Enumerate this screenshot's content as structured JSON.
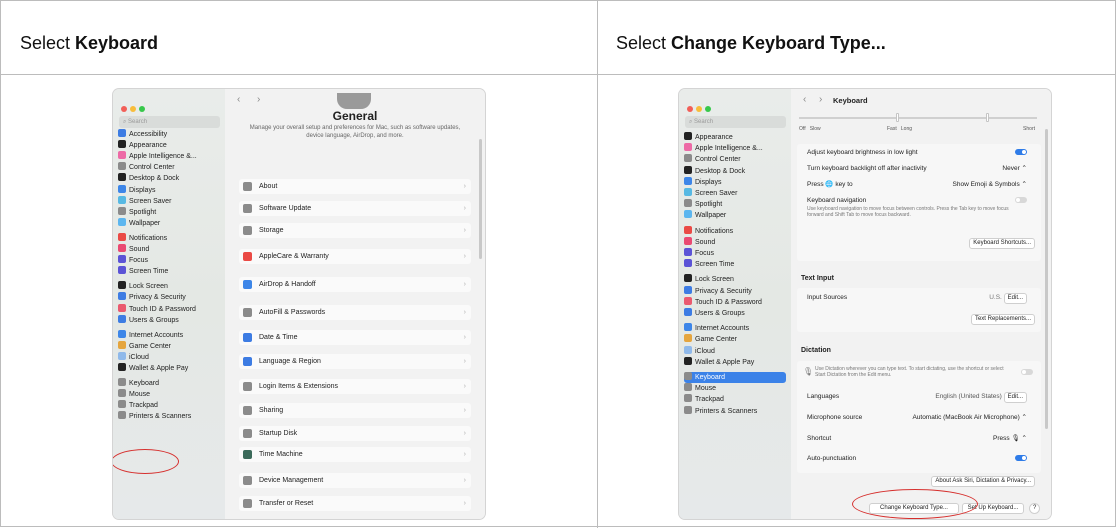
{
  "columns": [
    {
      "prefix": "Select ",
      "bold": "Keyboard"
    },
    {
      "prefix": "Select ",
      "bold": "Change Keyboard Type..."
    }
  ],
  "colors": {
    "accent": "#3b82e8",
    "highlight": "#d6302e",
    "close": "#f25f58",
    "minimize": "#f8bd3b",
    "zoom": "#37c84b"
  },
  "left": {
    "search_placeholder": "Search",
    "sidebar": [
      {
        "label": "Accessibility",
        "color": "#3d7ce3"
      },
      {
        "label": "Appearance",
        "color": "#222"
      },
      {
        "label": "Apple Intelligence &...",
        "color": "#ed6aa6"
      },
      {
        "label": "Control Center",
        "color": "#8b8b8b"
      },
      {
        "label": "Desktop & Dock",
        "color": "#222"
      },
      {
        "label": "Displays",
        "color": "#3d86e8"
      },
      {
        "label": "Screen Saver",
        "color": "#57b9e3"
      },
      {
        "label": "Spotlight",
        "color": "#8b8b8b"
      },
      {
        "label": "Wallpaper",
        "color": "#5cb6ef"
      },
      {
        "label": "Notifications",
        "color": "#ea4a45"
      },
      {
        "label": "Sound",
        "color": "#ea4a72"
      },
      {
        "label": "Focus",
        "color": "#5b53d6"
      },
      {
        "label": "Screen Time",
        "color": "#5b53d6"
      },
      {
        "label": "Lock Screen",
        "color": "#222"
      },
      {
        "label": "Privacy & Security",
        "color": "#3d7ce3"
      },
      {
        "label": "Touch ID & Password",
        "color": "#ea5a6f"
      },
      {
        "label": "Users & Groups",
        "color": "#3d7ce3"
      },
      {
        "label": "Internet Accounts",
        "color": "#3d86e8"
      },
      {
        "label": "Game Center",
        "color": "#e5a53e"
      },
      {
        "label": "iCloud",
        "color": "#8fb9ea"
      },
      {
        "label": "Wallet & Apple Pay",
        "color": "#222"
      },
      {
        "label": "Keyboard",
        "color": "#8b8b8b"
      },
      {
        "label": "Mouse",
        "color": "#8b8b8b"
      },
      {
        "label": "Trackpad",
        "color": "#8b8b8b"
      },
      {
        "label": "Printers & Scanners",
        "color": "#8b8b8b"
      }
    ],
    "header_title": "General",
    "header_desc": "Manage your overall setup and preferences for Mac, such as software updates, device language, AirDrop, and more.",
    "rows": [
      {
        "label": "About",
        "color": "#8b8b8b"
      },
      {
        "label": "Software Update",
        "color": "#8b8b8b"
      },
      {
        "label": "Storage",
        "color": "#8b8b8b"
      },
      {
        "label": "AppleCare & Warranty",
        "color": "#ea4a45"
      },
      {
        "label": "AirDrop & Handoff",
        "color": "#3d86e8"
      },
      {
        "label": "AutoFill & Passwords",
        "color": "#8b8b8b"
      },
      {
        "label": "Date & Time",
        "color": "#3d7ce3"
      },
      {
        "label": "Language & Region",
        "color": "#3d7ce3"
      },
      {
        "label": "Login Items & Extensions",
        "color": "#8b8b8b"
      },
      {
        "label": "Sharing",
        "color": "#8b8b8b"
      },
      {
        "label": "Startup Disk",
        "color": "#8b8b8b"
      },
      {
        "label": "Time Machine",
        "color": "#3b6a5a"
      },
      {
        "label": "Device Management",
        "color": "#8b8b8b"
      },
      {
        "label": "Transfer or Reset",
        "color": "#8b8b8b"
      }
    ]
  },
  "right": {
    "search_placeholder": "Search",
    "title": "Keyboard",
    "slider_left": [
      "Off",
      "Slow"
    ],
    "slider_mid": [
      "Fast",
      "Long"
    ],
    "slider_right": "Short",
    "sidebar": [
      {
        "label": "Appearance",
        "color": "#222"
      },
      {
        "label": "Apple Intelligence &...",
        "color": "#ed6aa6"
      },
      {
        "label": "Control Center",
        "color": "#8b8b8b"
      },
      {
        "label": "Desktop & Dock",
        "color": "#222"
      },
      {
        "label": "Displays",
        "color": "#3d86e8"
      },
      {
        "label": "Screen Saver",
        "color": "#57b9e3"
      },
      {
        "label": "Spotlight",
        "color": "#8b8b8b"
      },
      {
        "label": "Wallpaper",
        "color": "#5cb6ef"
      },
      {
        "label": "Notifications",
        "color": "#ea4a45"
      },
      {
        "label": "Sound",
        "color": "#ea4a72"
      },
      {
        "label": "Focus",
        "color": "#5b53d6"
      },
      {
        "label": "Screen Time",
        "color": "#5b53d6"
      },
      {
        "label": "Lock Screen",
        "color": "#222"
      },
      {
        "label": "Privacy & Security",
        "color": "#3d7ce3"
      },
      {
        "label": "Touch ID & Password",
        "color": "#ea5a6f"
      },
      {
        "label": "Users & Groups",
        "color": "#3d7ce3"
      },
      {
        "label": "Internet Accounts",
        "color": "#3d86e8"
      },
      {
        "label": "Game Center",
        "color": "#e5a53e"
      },
      {
        "label": "iCloud",
        "color": "#8fb9ea"
      },
      {
        "label": "Wallet & Apple Pay",
        "color": "#222"
      },
      {
        "label": "Keyboard",
        "color": "#8b8b8b"
      },
      {
        "label": "Mouse",
        "color": "#8b8b8b"
      },
      {
        "label": "Trackpad",
        "color": "#8b8b8b"
      },
      {
        "label": "Printers & Scanners",
        "color": "#8b8b8b"
      }
    ],
    "adjust_brightness": "Adjust keyboard brightness in low light",
    "backlight_off": "Turn keyboard backlight off after inactivity",
    "backlight_value": "Never",
    "press_key": "Press 🌐 key to",
    "press_value": "Show Emoji & Symbols",
    "kbd_nav": "Keyboard navigation",
    "kbd_nav_desc": "Use keyboard navigation to move focus between controls. Press the Tab key to move focus forward and Shift Tab to move focus backward.",
    "kbd_shortcuts": "Keyboard Shortcuts...",
    "text_input": "Text Input",
    "input_sources": "Input Sources",
    "input_value": "U.S.",
    "edit": "Edit...",
    "text_replacements": "Text Replacements...",
    "dictation": "Dictation",
    "dictation_desc": "Use Dictation wherever you can type text. To start dictating, use the shortcut or select Start Dictation from the Edit menu.",
    "languages": "Languages",
    "languages_value": "English (United States)",
    "mic_source": "Microphone source",
    "mic_value": "Automatic (MacBook Air Microphone)",
    "shortcut": "Shortcut",
    "shortcut_value": "Press 🎙",
    "auto_punct": "Auto-punctuation",
    "about_siri": "About Ask Siri, Dictation & Privacy...",
    "change_kbd": "Change Keyboard Type...",
    "setup_kbd": "Set Up Keyboard...",
    "help": "?"
  }
}
